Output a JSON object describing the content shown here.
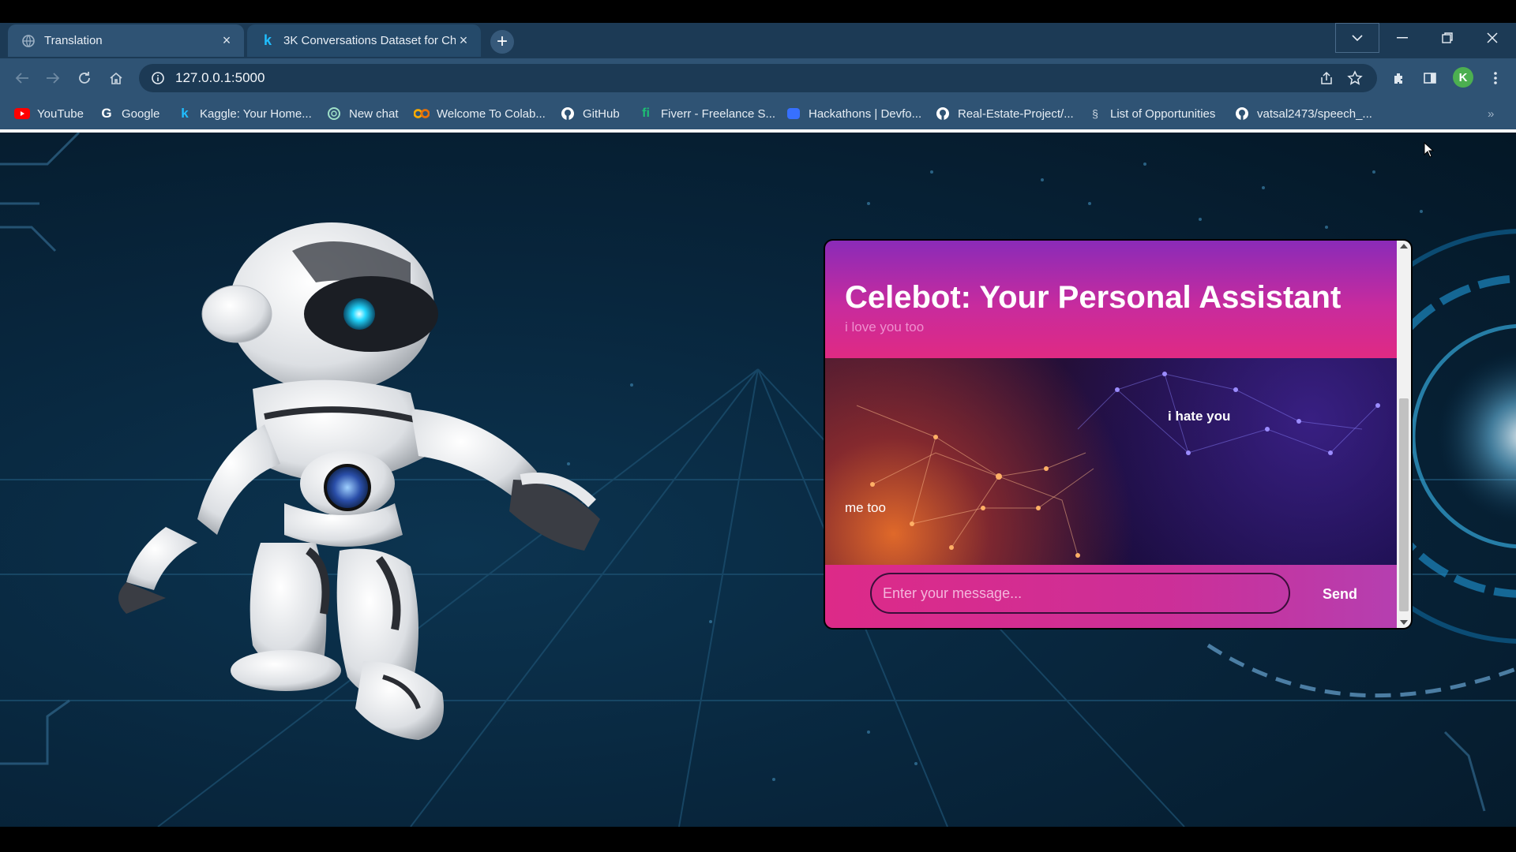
{
  "browser": {
    "tabs": [
      {
        "title": "Translation",
        "active": true
      },
      {
        "title": "3K Conversations Dataset for Chatbot",
        "active": false
      }
    ],
    "new_tab_label": "+",
    "address_bar": {
      "url": "127.0.0.1:5000"
    },
    "profile_initial": "K",
    "bookmarks": [
      {
        "label": "YouTube",
        "icon": "youtube-icon"
      },
      {
        "label": "Google",
        "icon": "google-icon"
      },
      {
        "label": "Kaggle: Your Home...",
        "icon": "kaggle-icon"
      },
      {
        "label": "New chat",
        "icon": "openai-icon"
      },
      {
        "label": "Welcome To Colab...",
        "icon": "colab-icon"
      },
      {
        "label": "GitHub",
        "icon": "github-icon"
      },
      {
        "label": "Fiverr - Freelance S...",
        "icon": "fiverr-icon"
      },
      {
        "label": "Hackathons | Devfo...",
        "icon": "devfolio-icon"
      },
      {
        "label": "Real-Estate-Project/...",
        "icon": "github-icon"
      },
      {
        "label": "List of Opportunities",
        "icon": "list-icon"
      },
      {
        "label": "vatsal2473/speech_...",
        "icon": "github-icon"
      }
    ]
  },
  "chat": {
    "title": "Celebot: Your Personal Assistant",
    "subtitle": "i love you too",
    "messages": [
      {
        "from": "user",
        "text": "i hate you"
      },
      {
        "from": "bot",
        "text": "me too"
      }
    ],
    "input_placeholder": "Enter your message...",
    "send_label": "Send"
  },
  "colors": {
    "browser_frame": "#2f5374",
    "tab_strip": "#1c3a55",
    "header_gradient_start": "#8a2bb8",
    "header_gradient_end": "#e02a83",
    "footer_pink": "#dd2a88",
    "page_background": "#08263d"
  }
}
